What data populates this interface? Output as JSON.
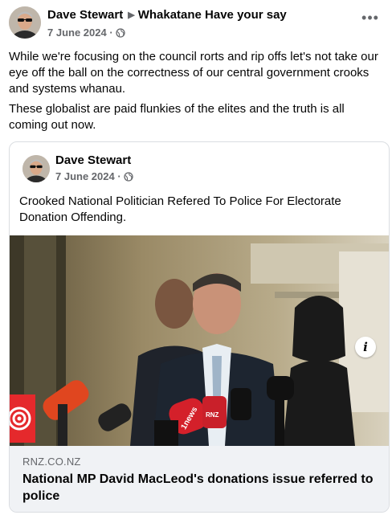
{
  "post": {
    "author": "Dave Stewart",
    "group": "Whakatane Have your say",
    "date": "7 June 2024",
    "paragraphs": [
      "While we're focusing on the council rorts and rip offs let's not take our eye off the ball on the correctness of our central government crooks and systems whanau.",
      "These globalist are paid flunkies of the elites and the truth is all coming out now."
    ],
    "more_label": "•••"
  },
  "shared": {
    "author": "Dave Stewart",
    "date": "7 June 2024",
    "text": "Crooked National Politician Refered To Police For Electorate Donation Offending.",
    "link": {
      "domain": "RNZ.CO.NZ",
      "title": "National MP David MacLeod's donations issue referred to police",
      "info_label": "i",
      "mic_labels": [
        "RNZ",
        "1news",
        "RNZ"
      ]
    }
  },
  "icons": [
    "globe-icon",
    "chevron-right-icon",
    "more-options-icon",
    "info-icon",
    "rnz-logo"
  ],
  "colors": {
    "text": "#050505",
    "secondary": "#65676b",
    "footer_bg": "#f0f2f5",
    "border": "#dadde1",
    "rnz_red": "#e5292c"
  }
}
